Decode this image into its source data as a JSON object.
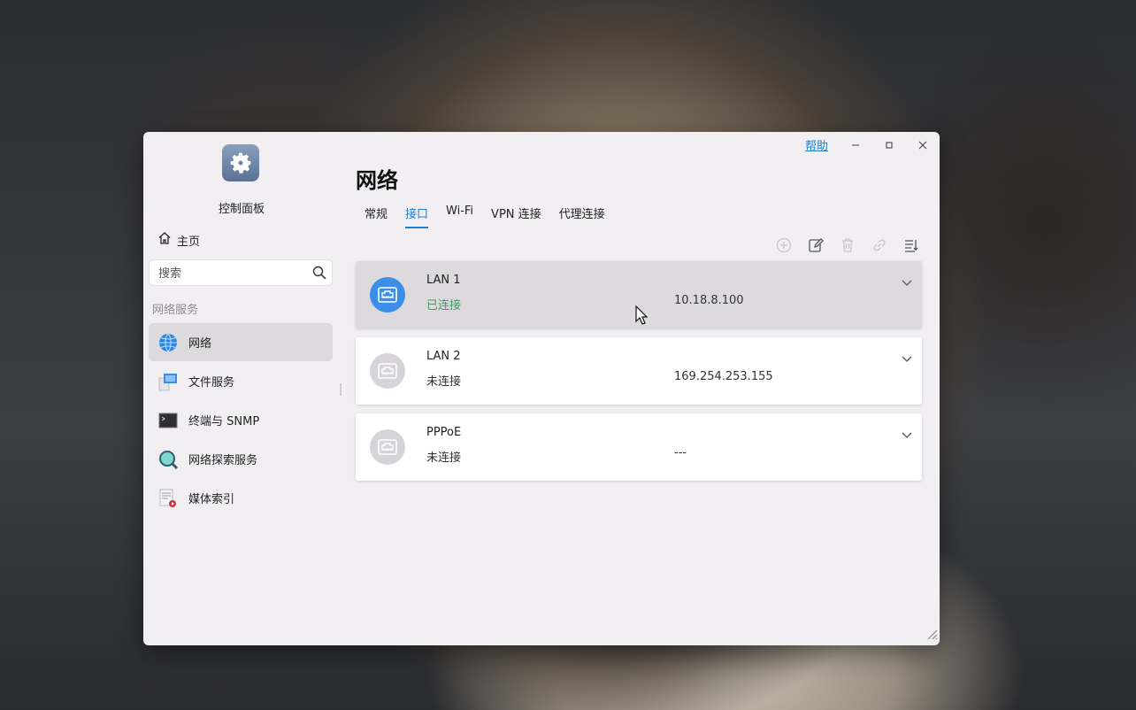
{
  "window": {
    "app_title": "控制面板",
    "help_label": "帮助"
  },
  "sidebar": {
    "home_label": "主页",
    "search_placeholder": "搜索",
    "section_label": "网络服务",
    "items": [
      {
        "label": "网络",
        "icon": "globe-icon"
      },
      {
        "label": "文件服务",
        "icon": "file-service-icon"
      },
      {
        "label": "终端与 SNMP",
        "icon": "terminal-icon"
      },
      {
        "label": "网络探索服务",
        "icon": "network-discovery-icon"
      },
      {
        "label": "媒体索引",
        "icon": "media-index-icon"
      }
    ]
  },
  "main": {
    "title": "网络",
    "tabs": [
      "常规",
      "接口",
      "Wi-Fi",
      "VPN 连接",
      "代理连接"
    ],
    "active_tab": "接口",
    "interfaces": [
      {
        "name": "LAN 1",
        "status": "已连接",
        "ip": "10.18.8.100"
      },
      {
        "name": "LAN 2",
        "status": "未连接",
        "ip": "169.254.253.155"
      },
      {
        "name": "PPPoE",
        "status": "未连接",
        "ip": "---"
      }
    ]
  },
  "colors": {
    "accent": "#1f7fd1",
    "connected": "#3a9d5d",
    "window_bg": "#f1eff2",
    "selected_bg": "#dcdadd"
  }
}
